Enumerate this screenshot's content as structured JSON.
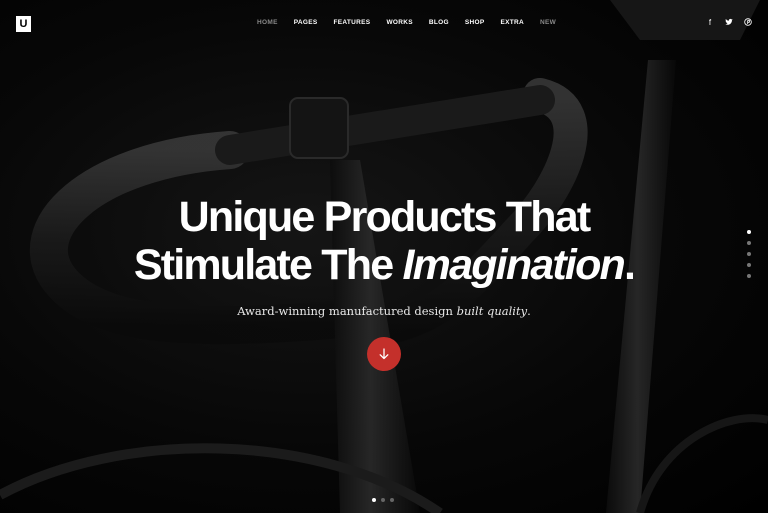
{
  "brand": {
    "logo_letter": "U"
  },
  "nav": {
    "items": [
      {
        "label": "HOME",
        "state": "dim"
      },
      {
        "label": "PAGES",
        "state": "normal"
      },
      {
        "label": "FEATURES",
        "state": "normal"
      },
      {
        "label": "WORKS",
        "state": "normal"
      },
      {
        "label": "BLOG",
        "state": "normal"
      },
      {
        "label": "SHOP",
        "state": "normal"
      },
      {
        "label": "EXTRA",
        "state": "normal"
      },
      {
        "label": "NEW",
        "state": "dim"
      }
    ]
  },
  "social": {
    "icons": [
      {
        "name": "facebook-icon",
        "glyph": "f"
      },
      {
        "name": "twitter-icon",
        "glyph": "🐦"
      },
      {
        "name": "pinterest-icon",
        "glyph": "℗"
      }
    ]
  },
  "hero": {
    "title_line1": "Unique Products That",
    "title_line2_plain": "Stimulate The",
    "title_line2_italic": "Imagination",
    "title_line2_end": ".",
    "subtitle_plain": "Award-winning manufactured design",
    "subtitle_italic": "built quality",
    "subtitle_end": ".",
    "scroll_button_icon": "arrow-down-icon"
  },
  "pagination": {
    "side_dots": 5,
    "side_active_index": 0,
    "bottom_dots": 3,
    "bottom_active_index": 0
  },
  "colors": {
    "accent": "#c4302b",
    "background": "#000000",
    "text": "#ffffff",
    "nav_dim": "#8a8a8a"
  }
}
